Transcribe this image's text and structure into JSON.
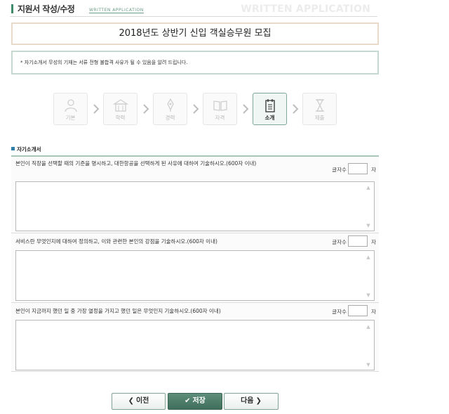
{
  "header": {
    "title": "지원서 작성/수정",
    "subtitle": "WRITTEN APPLICATION",
    "watermark": "WRITTEN APPLICATION"
  },
  "job_title": "2018년도 상반기 신입 객실승무원 모집",
  "notice": "* 자기소개서 무성의 기재는 서류 전형 불합격 사유가 될 수 있음을 알려 드립니다.",
  "steps": [
    {
      "label": "기본",
      "icon": "person-icon",
      "active": false
    },
    {
      "label": "학력",
      "icon": "school-icon",
      "active": false
    },
    {
      "label": "경력",
      "icon": "pen-icon",
      "active": false
    },
    {
      "label": "자격",
      "icon": "book-icon",
      "active": false
    },
    {
      "label": "소개",
      "icon": "notepad-icon",
      "active": true
    },
    {
      "label": "제출",
      "icon": "hourglass-icon",
      "active": false
    }
  ],
  "section_title": "자기소개서",
  "questions": [
    {
      "text": "본인이 직장을 선택할 때의 기준을 명시하고, 대한항공을 선택하게 된 사유에 대하여 기술하시오.(600자 이내)",
      "count_label": "글자수",
      "count_value": "",
      "count_unit": "자",
      "answer": ""
    },
    {
      "text": "서비스란 무엇인지에 대하여 정의하고, 이와 관련한 본인의 강점을 기술하시오.(600자 이내)",
      "count_label": "글자수",
      "count_value": "",
      "count_unit": "자",
      "answer": ""
    },
    {
      "text": "본인이 지금까지 했던 일 중 가장 열정을 가지고 했던 일은 무엇인지 기술하시오.(600자 이내)",
      "count_label": "글자수",
      "count_value": "",
      "count_unit": "자",
      "answer": ""
    }
  ],
  "buttons": {
    "prev": "이전",
    "save": "저장",
    "next": "다음"
  },
  "colors": {
    "accent": "#3f6e5a",
    "border_green": "#c5d9d0",
    "border_beige": "#e8d9c9"
  }
}
